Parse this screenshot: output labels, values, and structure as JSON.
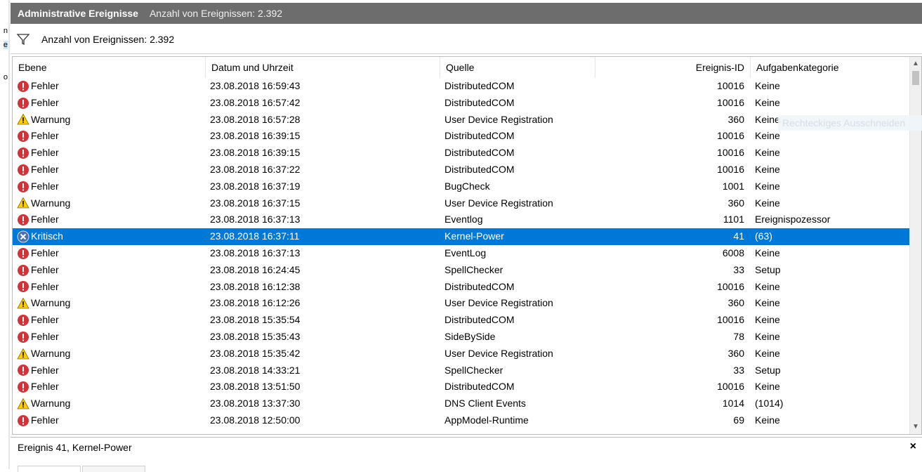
{
  "left_fragments": [
    "n",
    "e",
    "o"
  ],
  "header": {
    "title": "Administrative Ereignisse",
    "subtitle": "Anzahl von Ereignissen: 2.392"
  },
  "filter": {
    "icon": "filter-icon",
    "count_label": "Anzahl von Ereignissen: 2.392"
  },
  "columns": {
    "level": "Ebene",
    "date": "Datum und Uhrzeit",
    "source": "Quelle",
    "id": "Ereignis-ID",
    "category": "Aufgabenkategorie"
  },
  "overlay_text": "Rechteckiges Ausschneiden",
  "events": [
    {
      "level": "Fehler",
      "type": "error",
      "date": "23.08.2018 16:59:43",
      "source": "DistributedCOM",
      "id": "10016",
      "category": "Keine"
    },
    {
      "level": "Fehler",
      "type": "error",
      "date": "23.08.2018 16:57:42",
      "source": "DistributedCOM",
      "id": "10016",
      "category": "Keine"
    },
    {
      "level": "Warnung",
      "type": "warning",
      "date": "23.08.2018 16:57:28",
      "source": "User Device Registration",
      "id": "360",
      "category": "Keine"
    },
    {
      "level": "Fehler",
      "type": "error",
      "date": "23.08.2018 16:39:15",
      "source": "DistributedCOM",
      "id": "10016",
      "category": "Keine"
    },
    {
      "level": "Fehler",
      "type": "error",
      "date": "23.08.2018 16:39:15",
      "source": "DistributedCOM",
      "id": "10016",
      "category": "Keine"
    },
    {
      "level": "Fehler",
      "type": "error",
      "date": "23.08.2018 16:37:22",
      "source": "DistributedCOM",
      "id": "10016",
      "category": "Keine"
    },
    {
      "level": "Fehler",
      "type": "error",
      "date": "23.08.2018 16:37:19",
      "source": "BugCheck",
      "id": "1001",
      "category": "Keine"
    },
    {
      "level": "Warnung",
      "type": "warning",
      "date": "23.08.2018 16:37:15",
      "source": "User Device Registration",
      "id": "360",
      "category": "Keine"
    },
    {
      "level": "Fehler",
      "type": "error",
      "date": "23.08.2018 16:37:13",
      "source": "Eventlog",
      "id": "1101",
      "category": "Ereignispozessor"
    },
    {
      "level": "Kritisch",
      "type": "critical",
      "date": "23.08.2018 16:37:11",
      "source": "Kernel-Power",
      "id": "41",
      "category": "(63)",
      "selected": true
    },
    {
      "level": "Fehler",
      "type": "error",
      "date": "23.08.2018 16:37:13",
      "source": "EventLog",
      "id": "6008",
      "category": "Keine"
    },
    {
      "level": "Fehler",
      "type": "error",
      "date": "23.08.2018 16:24:45",
      "source": "SpellChecker",
      "id": "33",
      "category": "Setup"
    },
    {
      "level": "Fehler",
      "type": "error",
      "date": "23.08.2018 16:12:38",
      "source": "DistributedCOM",
      "id": "10016",
      "category": "Keine"
    },
    {
      "level": "Warnung",
      "type": "warning",
      "date": "23.08.2018 16:12:26",
      "source": "User Device Registration",
      "id": "360",
      "category": "Keine"
    },
    {
      "level": "Fehler",
      "type": "error",
      "date": "23.08.2018 15:35:54",
      "source": "DistributedCOM",
      "id": "10016",
      "category": "Keine"
    },
    {
      "level": "Fehler",
      "type": "error",
      "date": "23.08.2018 15:35:43",
      "source": "SideBySide",
      "id": "78",
      "category": "Keine"
    },
    {
      "level": "Warnung",
      "type": "warning",
      "date": "23.08.2018 15:35:42",
      "source": "User Device Registration",
      "id": "360",
      "category": "Keine"
    },
    {
      "level": "Fehler",
      "type": "error",
      "date": "23.08.2018 14:33:21",
      "source": "SpellChecker",
      "id": "33",
      "category": "Setup"
    },
    {
      "level": "Fehler",
      "type": "error",
      "date": "23.08.2018 13:51:50",
      "source": "DistributedCOM",
      "id": "10016",
      "category": "Keine"
    },
    {
      "level": "Warnung",
      "type": "warning",
      "date": "23.08.2018 13:37:30",
      "source": "DNS Client Events",
      "id": "1014",
      "category": "(1014)"
    },
    {
      "level": "Fehler",
      "type": "error",
      "date": "23.08.2018 12:50:00",
      "source": "AppModel-Runtime",
      "id": "69",
      "category": "Keine"
    }
  ],
  "detail": {
    "title": "Ereignis 41, Kernel-Power",
    "close_glyph": "×"
  },
  "colors": {
    "title_bar": "#6d6d6d",
    "selection": "#0078d7",
    "error": "#d13438",
    "warning": "#ffcc00",
    "critical": "#4a6fb5"
  }
}
